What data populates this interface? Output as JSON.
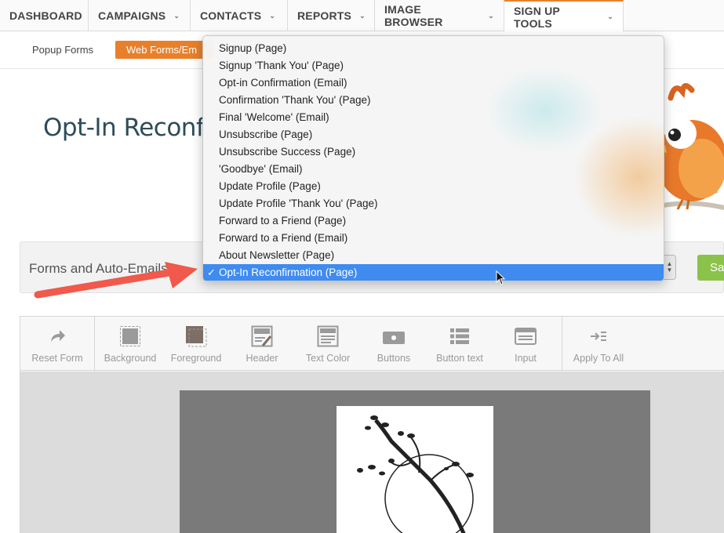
{
  "topnav": {
    "items": [
      {
        "label": "DASHBOARD",
        "chevron": false
      },
      {
        "label": "CAMPAIGNS",
        "chevron": true
      },
      {
        "label": "CONTACTS",
        "chevron": true
      },
      {
        "label": "REPORTS",
        "chevron": true
      },
      {
        "label": "IMAGE BROWSER",
        "chevron": true
      },
      {
        "label": "SIGN UP TOOLS",
        "chevron": true,
        "active": true
      }
    ]
  },
  "subnav": {
    "tabs": [
      {
        "label": "Popup Forms"
      },
      {
        "label": "Web Forms/Em",
        "active": true
      }
    ]
  },
  "page": {
    "title": "Opt-In Reconf"
  },
  "forms_bar": {
    "label": "Forms and Auto-Emails",
    "save_label": "Sa"
  },
  "dropdown": {
    "selected_index": 13,
    "items": [
      "Signup (Page)",
      "Signup 'Thank You' (Page)",
      "Opt-in Confirmation (Email)",
      "Confirmation 'Thank You' (Page)",
      "Final 'Welcome' (Email)",
      "Unsubscribe (Page)",
      "Unsubscribe Success (Page)",
      "'Goodbye' (Email)",
      "Update Profile (Page)",
      "Update Profile 'Thank You' (Page)",
      "Forward to a Friend (Page)",
      "Forward to a Friend (Email)",
      "About Newsletter (Page)",
      "Opt-In Reconfirmation (Page)"
    ]
  },
  "toolbar": {
    "tools": [
      {
        "label": "Reset Form",
        "icon": "reset-arrow-icon"
      },
      {
        "label": "Background",
        "icon": "background-icon"
      },
      {
        "label": "Foreground",
        "icon": "foreground-icon"
      },
      {
        "label": "Header",
        "icon": "header-icon"
      },
      {
        "label": "Text Color",
        "icon": "text-color-icon"
      },
      {
        "label": "Buttons",
        "icon": "buttons-icon"
      },
      {
        "label": "Button text",
        "icon": "button-text-icon"
      },
      {
        "label": "Input",
        "icon": "input-icon"
      },
      {
        "label": "Apply To All",
        "icon": "apply-to-all-icon"
      }
    ]
  },
  "colors": {
    "accent": "#e8802b",
    "selection": "#3f8bf0",
    "title": "#2d4c59",
    "save": "#8bc34a",
    "arrow": "#f0594b"
  }
}
